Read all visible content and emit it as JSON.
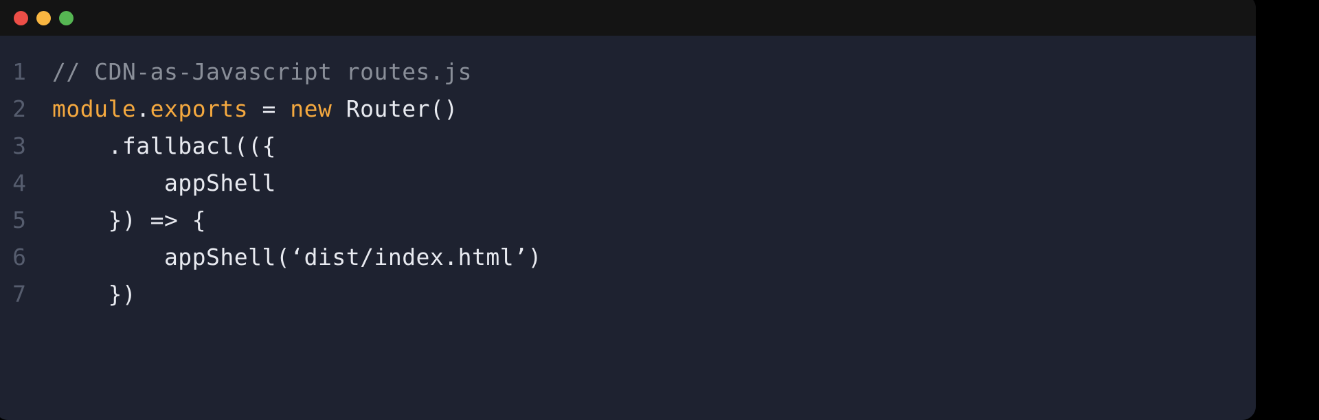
{
  "window": {
    "titlebar": {
      "buttons": [
        {
          "name": "close",
          "label": "close-button",
          "color": "#ed4e47"
        },
        {
          "name": "minimize",
          "label": "minimize-button",
          "color": "#f9b641"
        },
        {
          "name": "maximize",
          "label": "maximize-button",
          "color": "#56b653"
        }
      ]
    },
    "background": "#1e2230",
    "titlebar_background": "#141414",
    "page_background": "#000000"
  },
  "editor": {
    "language": "javascript",
    "gutter_color": "#565d6e",
    "text_color": "#e8eaf0",
    "comment_color": "#8a8f99",
    "keyword_color": "#f5a93f",
    "lines": [
      {
        "number": "1",
        "plain": "// CDN-as-Javascript routes.js",
        "tokens": [
          {
            "text": "// CDN-as-Javascript routes.js",
            "type": "comment"
          }
        ]
      },
      {
        "number": "2",
        "plain": "module.exports = new Router()",
        "tokens": [
          {
            "text": "module",
            "type": "keyword"
          },
          {
            "text": ".",
            "type": "plain"
          },
          {
            "text": "exports",
            "type": "keyword"
          },
          {
            "text": " = ",
            "type": "plain"
          },
          {
            "text": "new",
            "type": "keyword"
          },
          {
            "text": " Router()",
            "type": "plain"
          }
        ]
      },
      {
        "number": "3",
        "plain": "    .fallbacl(({",
        "tokens": [
          {
            "text": "    .fallbacl(({",
            "type": "plain"
          }
        ]
      },
      {
        "number": "4",
        "plain": "        appShell",
        "tokens": [
          {
            "text": "        appShell",
            "type": "plain"
          }
        ]
      },
      {
        "number": "5",
        "plain": "    }) => {",
        "tokens": [
          {
            "text": "    }) => {",
            "type": "plain"
          }
        ]
      },
      {
        "number": "6",
        "plain": "        appShell(‘dist/index.html’)",
        "tokens": [
          {
            "text": "        appShell(‘dist/index.html’)",
            "type": "plain"
          }
        ]
      },
      {
        "number": "7",
        "plain": "    })",
        "tokens": [
          {
            "text": "    })",
            "type": "plain"
          }
        ]
      }
    ]
  }
}
